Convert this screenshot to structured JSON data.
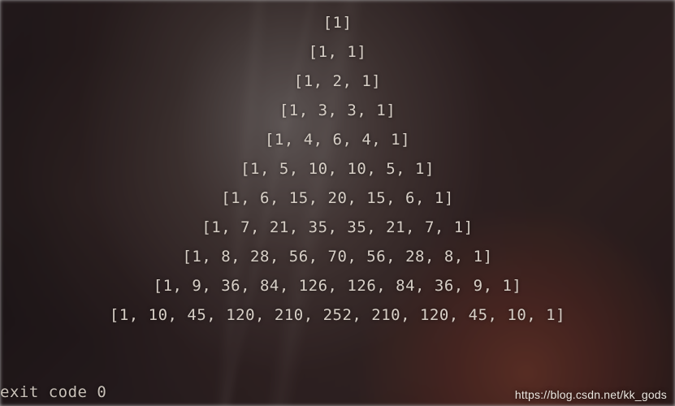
{
  "output": {
    "rows": [
      [
        1
      ],
      [
        1,
        1
      ],
      [
        1,
        2,
        1
      ],
      [
        1,
        3,
        3,
        1
      ],
      [
        1,
        4,
        6,
        4,
        1
      ],
      [
        1,
        5,
        10,
        10,
        5,
        1
      ],
      [
        1,
        6,
        15,
        20,
        15,
        6,
        1
      ],
      [
        1,
        7,
        21,
        35,
        35,
        21,
        7,
        1
      ],
      [
        1,
        8,
        28,
        56,
        70,
        56,
        28,
        8,
        1
      ],
      [
        1,
        9,
        36,
        84,
        126,
        126,
        84,
        36,
        9,
        1
      ],
      [
        1,
        10,
        45,
        120,
        210,
        252,
        210,
        120,
        45,
        10,
        1
      ]
    ]
  },
  "status_text": "exit code 0",
  "watermark": "https://blog.csdn.net/kk_gods"
}
